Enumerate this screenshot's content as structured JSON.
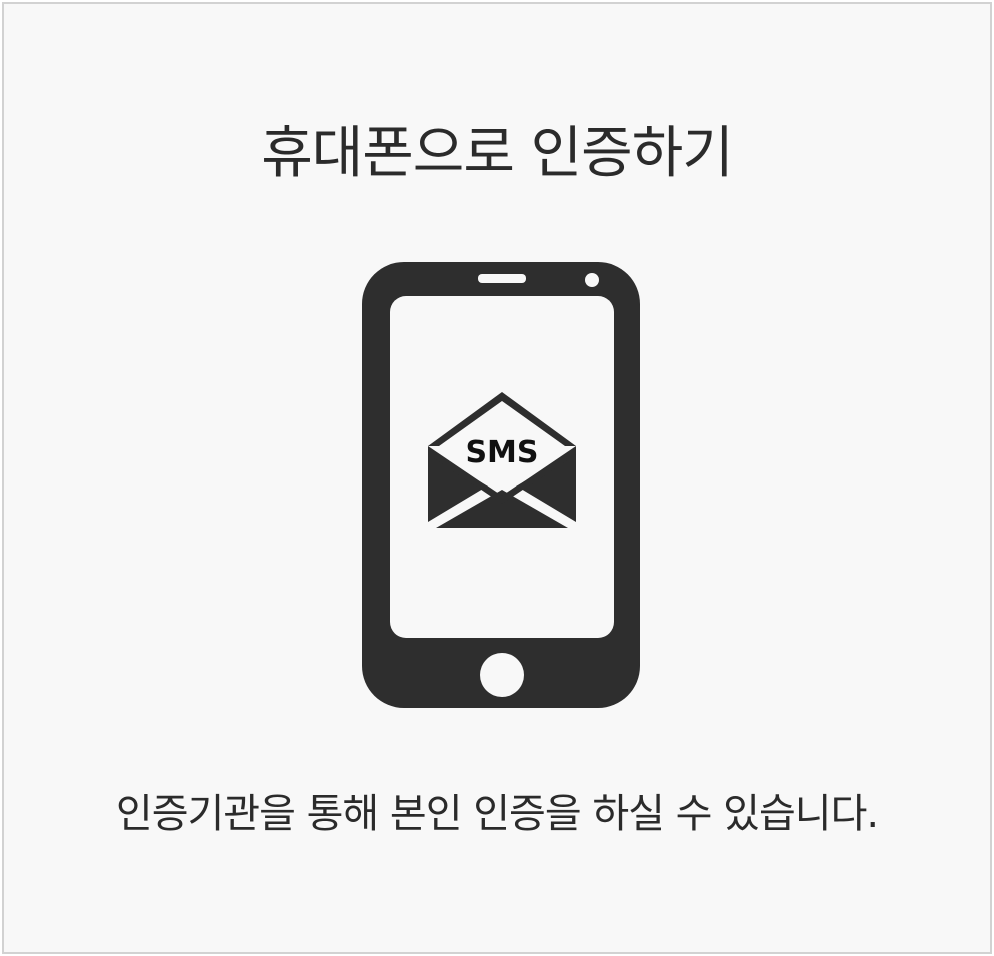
{
  "card": {
    "title": "휴대폰으로 인증하기",
    "icon": "mobile-sms-icon",
    "sms_label": "SMS",
    "description": "인증기관을 통해 본인 인증을 하실 수 있습니다."
  },
  "colors": {
    "card_background": "#f8f8f8",
    "card_border": "#d2d2d2",
    "text": "#2b2b2b",
    "icon_dark": "#2e2e2e"
  }
}
